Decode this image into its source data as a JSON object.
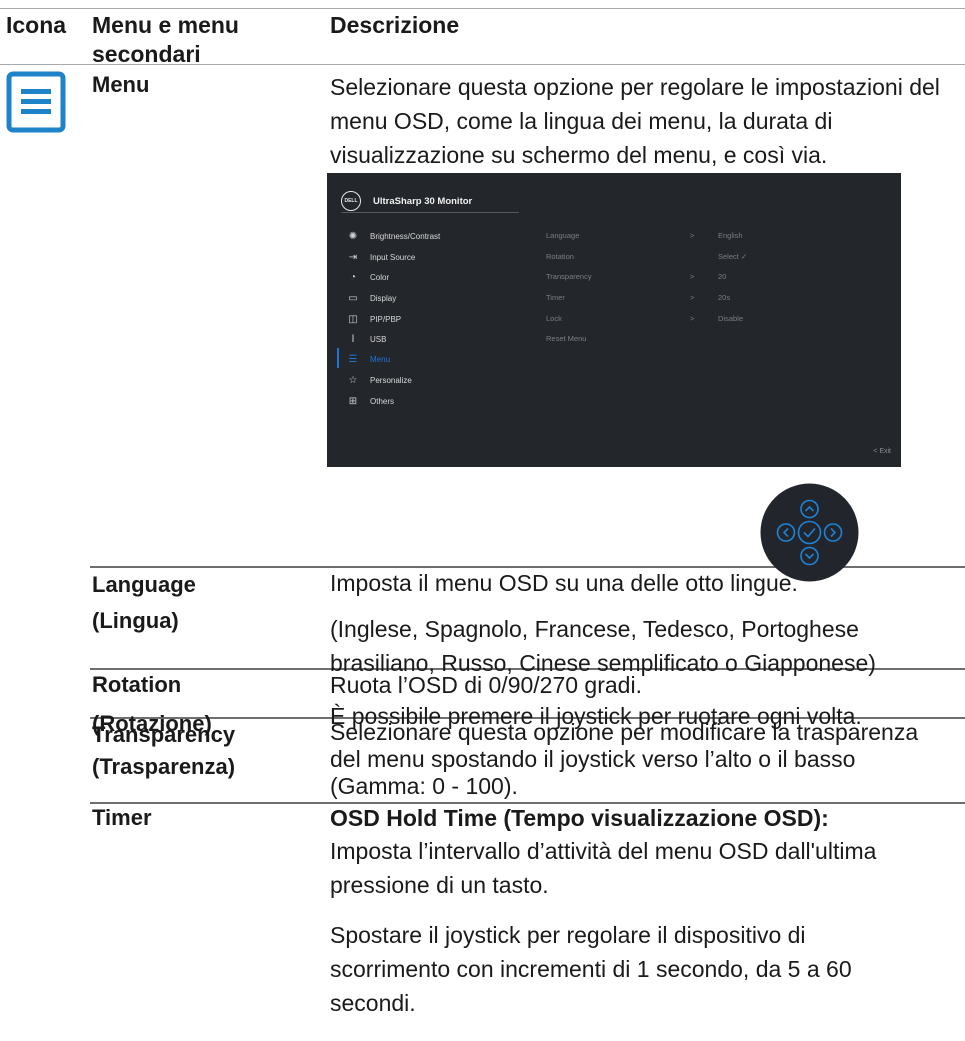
{
  "header": {
    "col_icon": "Icona",
    "col_menu_line1": "Menu e menu",
    "col_menu_line2": "secondari",
    "col_desc": "Descrizione"
  },
  "menu_row": {
    "name": "Menu",
    "description": "Selezionare questa opzione per regolare le impostazioni del menu OSD, come la lingua dei menu, la durata di visualizzazione su schermo del menu, e così via.",
    "icon": "menu-list-icon"
  },
  "osd": {
    "logo": "DELL",
    "title": "UltraSharp 30 Monitor",
    "left_menu": [
      {
        "label": "Brightness/Contrast",
        "icon": "brightness-icon"
      },
      {
        "label": "Input Source",
        "icon": "input-source-icon"
      },
      {
        "label": "Color",
        "icon": "color-icon"
      },
      {
        "label": "Display",
        "icon": "display-icon"
      },
      {
        "label": "PIP/PBP",
        "icon": "pip-pbp-icon"
      },
      {
        "label": "USB",
        "icon": "usb-icon"
      },
      {
        "label": "Menu",
        "icon": "menu-icon",
        "active": true
      },
      {
        "label": "Personalize",
        "icon": "star-icon"
      },
      {
        "label": "Others",
        "icon": "others-icon"
      }
    ],
    "right_menu": [
      {
        "label": "Language",
        "chevron": ">",
        "value": "English"
      },
      {
        "label": "Rotation",
        "chevron": "",
        "value": "Select ✓"
      },
      {
        "label": "Transparency",
        "chevron": ">",
        "value": "20"
      },
      {
        "label": "Timer",
        "chevron": ">",
        "value": "20s"
      },
      {
        "label": "Lock",
        "chevron": ">",
        "value": "Disable"
      },
      {
        "label": "Reset Menu",
        "chevron": "",
        "value": ""
      }
    ],
    "exit_label": "<  Exit",
    "accent_color": "#1e75d8"
  },
  "rows": [
    {
      "name_lines": [
        "Language",
        "(Lingua)"
      ],
      "desc_paragraphs": [
        [
          "Imposta il menu OSD su una delle otto lingue."
        ],
        [
          "(Inglese, Spagnolo, Francese, Tedesco, Portoghese",
          "brasiliano, Russo, Cinese semplificato o Giapponese)"
        ]
      ]
    },
    {
      "name_lines": [
        "Rotation",
        "(Rotazione)"
      ],
      "desc_paragraphs": [
        [
          "Ruota l’OSD di 0/90/270 gradi.",
          "È possibile premere il joystick per ruotare ogni volta."
        ]
      ]
    },
    {
      "name_lines": [
        "Transparency",
        "(Trasparenza)"
      ],
      "desc_paragraphs": [
        [
          "Selezionare questa opzione per modificare la trasparenza",
          "del menu spostando il joystick verso l’alto o il basso",
          "(Gamma: 0 - 100)."
        ]
      ]
    },
    {
      "name_lines": [
        "Timer"
      ],
      "desc_bold": "OSD Hold Time (Tempo visualizzazione OSD):",
      "desc_paragraphs": [
        [
          "Imposta l’intervallo d’attività del menu OSD dall'ultima",
          "pressione di un tasto."
        ],
        [
          "Spostare il joystick per regolare il dispositivo di",
          "scorrimento con incrementi di 1 secondo, da 5 a 60",
          "secondi."
        ]
      ]
    }
  ]
}
